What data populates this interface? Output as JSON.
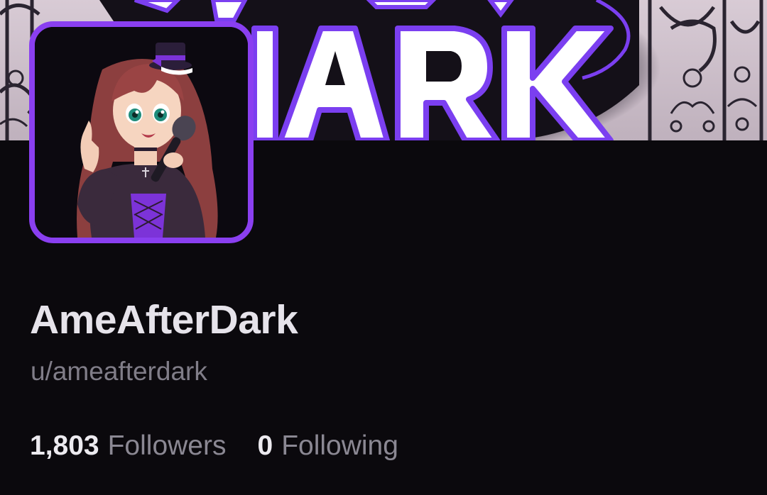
{
  "profile": {
    "display_name": "AmeAfterDark",
    "username": "u/ameafterdark"
  },
  "stats": {
    "followers": {
      "count": "1,803",
      "label": "Followers"
    },
    "following": {
      "count": "0",
      "label": "Following"
    }
  },
  "theme": {
    "background": "#0b090d",
    "accent": "#8a3ff0",
    "primary_text": "#e6e3ea",
    "secondary_text": "#807d88"
  },
  "images": {
    "banner": "gothic-gate-logo-banner",
    "avatar": "anime-singer-avatar"
  }
}
